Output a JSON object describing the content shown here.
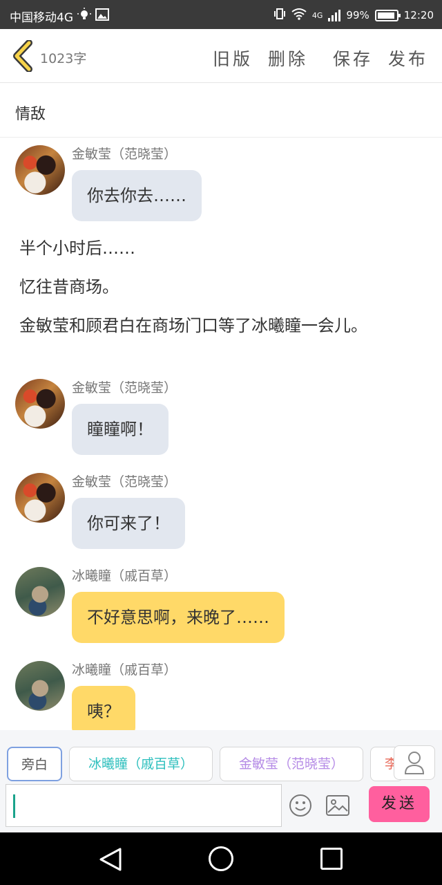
{
  "status_bar": {
    "carrier": "中国移动4G",
    "battery": "99%",
    "time": "12:20",
    "network": "4G"
  },
  "header": {
    "word_count": "1023字",
    "actions": [
      "旧版",
      "删除",
      "保存",
      "发布"
    ]
  },
  "story_title": "情敌",
  "messages": [
    {
      "kind": "dialog",
      "sender": "金敏莹（范晓莹）",
      "text": "你去你去……",
      "color": "gray",
      "avatar": "a1"
    },
    {
      "kind": "narration",
      "text": "半个小时后……"
    },
    {
      "kind": "narration",
      "text": "忆往昔商场。"
    },
    {
      "kind": "narration",
      "text": "金敏莹和顾君白在商场门口等了冰曦瞳一会儿。"
    },
    {
      "kind": "dialog",
      "sender": "金敏莹（范晓莹）",
      "text": "瞳瞳啊！",
      "color": "gray",
      "avatar": "a1"
    },
    {
      "kind": "dialog",
      "sender": "金敏莹（范晓莹）",
      "text": "你可来了！",
      "color": "gray",
      "avatar": "a1"
    },
    {
      "kind": "dialog",
      "sender": "冰曦瞳（戚百草）",
      "text": "不好意思啊，来晚了……",
      "color": "yellow",
      "avatar": "a2"
    },
    {
      "kind": "dialog",
      "sender": "冰曦瞳（戚百草）",
      "text": "咦？",
      "color": "yellow",
      "avatar": "a2"
    }
  ],
  "roles": {
    "narrator": "旁白",
    "role1": "冰曦瞳（戚百草）",
    "role2": "金敏莹（范晓莹）",
    "role3": "李"
  },
  "input": {
    "value": "",
    "send_label": "发送"
  },
  "colors": {
    "bubble_gray": "#e2e7ef",
    "bubble_yellow": "#ffd968",
    "send": "#ff5f9e",
    "role1": "#2dbfbd",
    "role2": "#b58be6"
  },
  "icons": [
    "back-chevron-icon",
    "emoji-icon",
    "image-icon",
    "user-icon",
    "nav-back-icon",
    "nav-home-icon",
    "nav-recent-icon"
  ]
}
